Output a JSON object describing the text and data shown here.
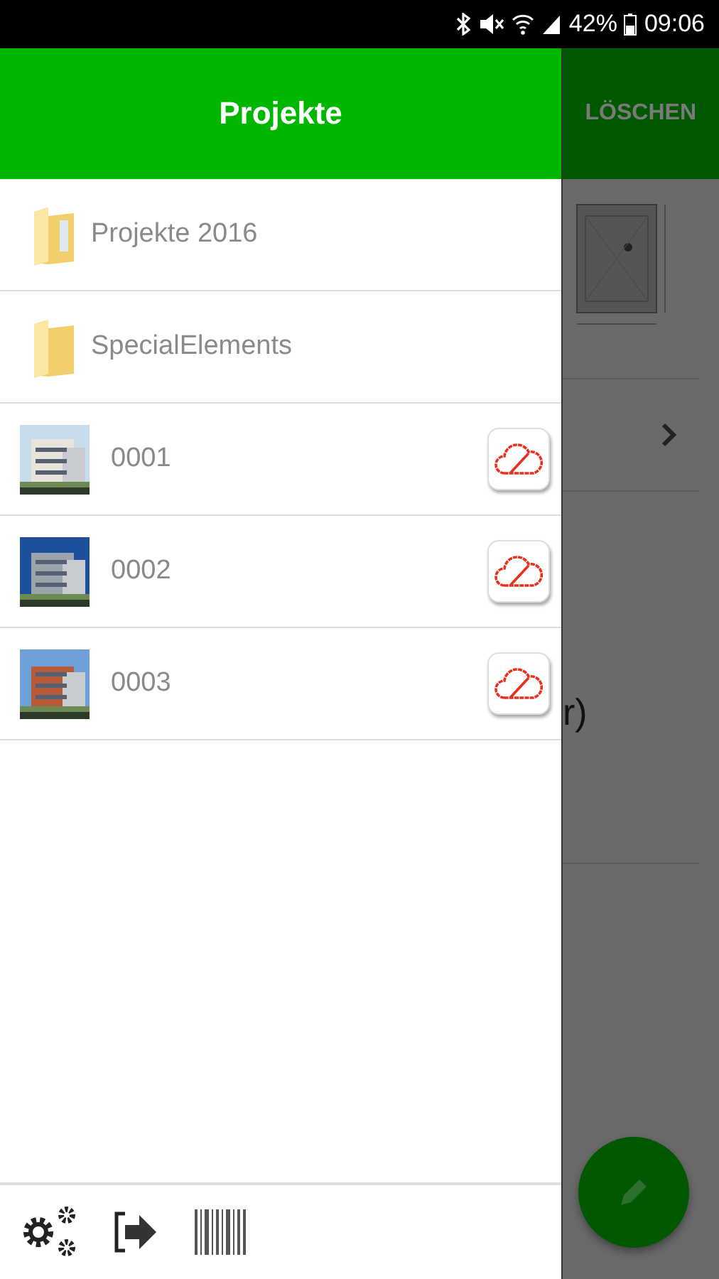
{
  "status_bar": {
    "battery": "42%",
    "time": "09:06"
  },
  "drawer": {
    "title": "Projekte",
    "items": [
      {
        "kind": "folder",
        "label": "Projekte 2016"
      },
      {
        "kind": "folder",
        "label": "SpecialElements"
      },
      {
        "kind": "project",
        "label": "0001"
      },
      {
        "kind": "project",
        "label": "0002"
      },
      {
        "kind": "project",
        "label": "0003"
      }
    ]
  },
  "background": {
    "action": "LÖSCHEN",
    "partial_text": "r)"
  }
}
